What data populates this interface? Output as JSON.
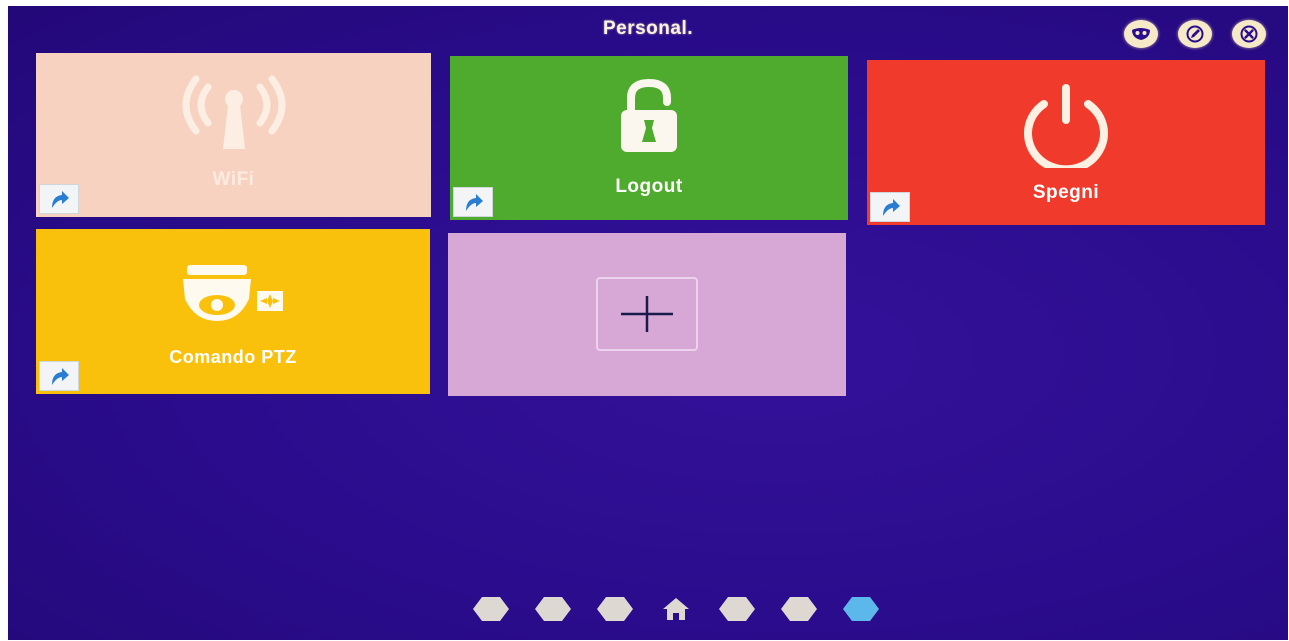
{
  "header": {
    "title": "Personal.",
    "buttons": [
      {
        "name": "mask-icon"
      },
      {
        "name": "edit-icon"
      },
      {
        "name": "close-icon"
      }
    ]
  },
  "tiles": [
    {
      "id": "wifi",
      "label": "WiFi",
      "icon": "wifi-antenna-icon",
      "color": "#f8d2c0",
      "shortcut": true
    },
    {
      "id": "logout",
      "label": "Logout",
      "icon": "padlock-icon",
      "color": "#4fab2e",
      "shortcut": true
    },
    {
      "id": "spegni",
      "label": "Spegni",
      "icon": "power-icon",
      "color": "#ef3a2c",
      "shortcut": true
    },
    {
      "id": "ptz",
      "label": "Comando PTZ",
      "icon": "ptz-camera-icon",
      "color": "#f9c10b",
      "shortcut": true
    },
    {
      "id": "add",
      "label": "",
      "icon": "plus-icon",
      "color": "#d7a7d6",
      "shortcut": false
    }
  ],
  "pager": {
    "pages": 7,
    "home_index": 3,
    "active_index": 6,
    "active_color": "#5cb7ea"
  },
  "colors": {
    "background": "#2a0c8c",
    "text": "#ffffff"
  }
}
